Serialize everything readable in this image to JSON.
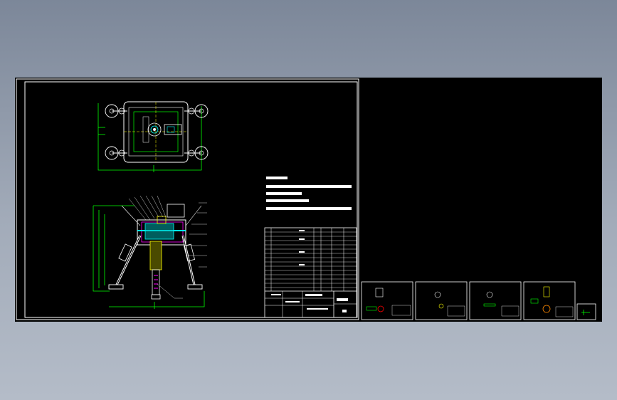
{
  "colors": {
    "background_top": "#7c8799",
    "background_bottom": "#b4bcc8",
    "canvas": "#000000",
    "line_white": "#ffffff",
    "line_green": "#00ff00",
    "line_cyan": "#00ffff",
    "line_yellow": "#ffff00",
    "line_magenta": "#ff00ff"
  },
  "icons": [
    "bolt-cap-icon",
    "leg-pad-icon"
  ]
}
